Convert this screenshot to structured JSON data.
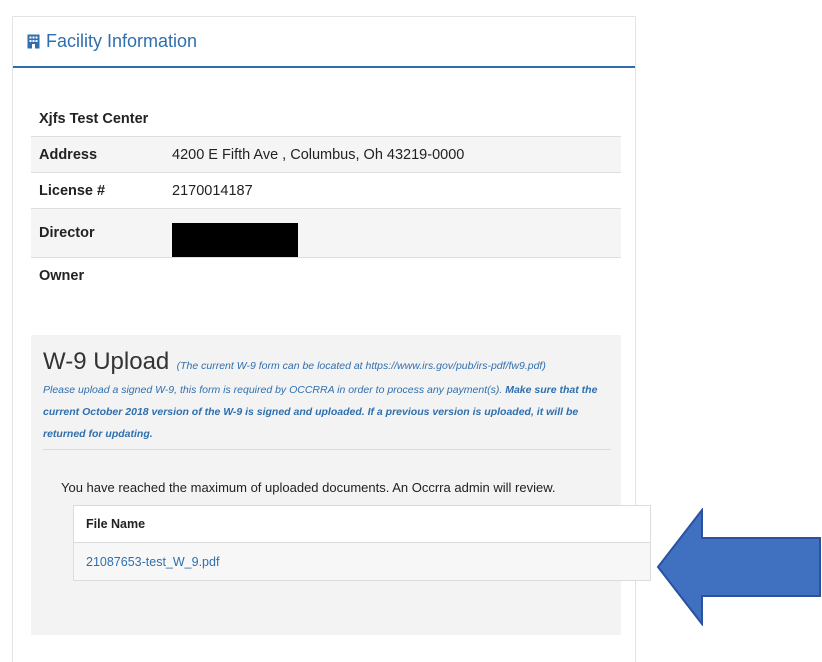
{
  "panel": {
    "title": "Facility Information"
  },
  "facility": {
    "name": "Xjfs Test Center",
    "rows": [
      {
        "label": "Address",
        "value": "4200 E Fifth Ave , Columbus, Oh 43219-0000"
      },
      {
        "label": "License #",
        "value": "2170014187"
      },
      {
        "label": "Director",
        "value": ""
      },
      {
        "label": "Owner",
        "value": ""
      }
    ]
  },
  "w9": {
    "title": "W-9 Upload",
    "hint": "(The current W-9 form can be located at https://www.irs.gov/pub/irs-pdf/fw9.pdf)",
    "desc_plain": "Please upload a signed W-9, this form is required by OCCRRA in order to process any payment(s).",
    "desc_bold": "Make sure that the current October 2018 version of the W-9 is signed and uploaded. If a previous version is uploaded, it will be returned for updating.",
    "notice": "You have reached the maximum of uploaded documents. An Occrra admin will review.",
    "table": {
      "header": "File Name",
      "files": [
        "21087653-test_W_9.pdf"
      ]
    }
  },
  "colors": {
    "accent": "#2f6fae",
    "arrow": "#3f71c0",
    "arrow_border": "#2a52a0"
  },
  "icons": {
    "heading": "building-icon",
    "pointer": "arrow-left-icon"
  }
}
